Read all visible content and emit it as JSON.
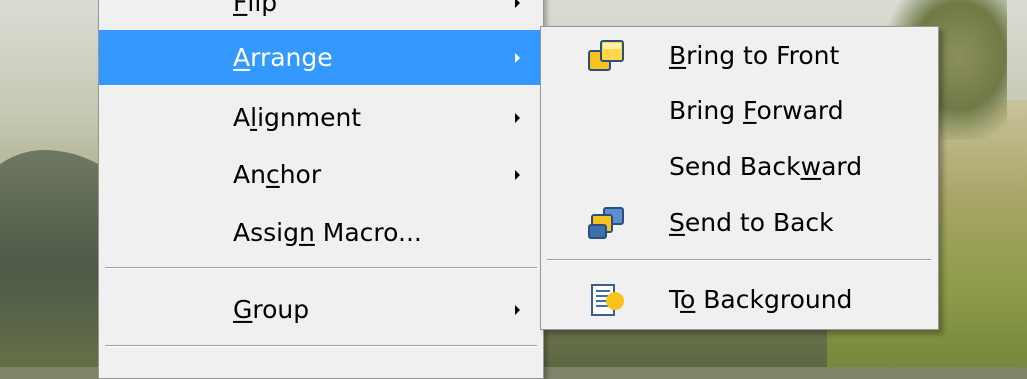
{
  "main_menu": {
    "items": [
      {
        "label_pre": "",
        "label_u": "F",
        "label_post": "lip",
        "has_submenu": true,
        "highlighted": false
      },
      {
        "label_pre": "",
        "label_u": "A",
        "label_post": "rrange",
        "has_submenu": true,
        "highlighted": true
      },
      {
        "label_pre": "A",
        "label_u": "l",
        "label_post": "ignment",
        "has_submenu": true,
        "highlighted": false
      },
      {
        "label_pre": "An",
        "label_u": "c",
        "label_post": "hor",
        "has_submenu": true,
        "highlighted": false
      },
      {
        "label_pre": "Assig",
        "label_u": "n",
        "label_post": " Macro...",
        "has_submenu": false,
        "highlighted": false
      },
      {
        "label_pre": "",
        "label_u": "G",
        "label_post": "roup",
        "has_submenu": true,
        "highlighted": false
      }
    ]
  },
  "arrange_submenu": {
    "items": [
      {
        "label_pre": "",
        "label_u": "B",
        "label_post": "ring to Front",
        "icon": "bring-to-front-icon"
      },
      {
        "label_pre": "Bring ",
        "label_u": "F",
        "label_post": "orward",
        "icon": ""
      },
      {
        "label_pre": "Send Back",
        "label_u": "w",
        "label_post": "ard",
        "icon": ""
      },
      {
        "label_pre": "",
        "label_u": "S",
        "label_post": "end to Back",
        "icon": "send-to-back-icon"
      },
      {
        "label_pre": "T",
        "label_u": "o",
        "label_post": " Background",
        "icon": "to-background-icon"
      }
    ]
  },
  "colors": {
    "highlight": "#3399ff",
    "menu_background": "#f0f0f0",
    "icon_yellow": "#f7c21b",
    "icon_blue": "#3d6fa8"
  }
}
